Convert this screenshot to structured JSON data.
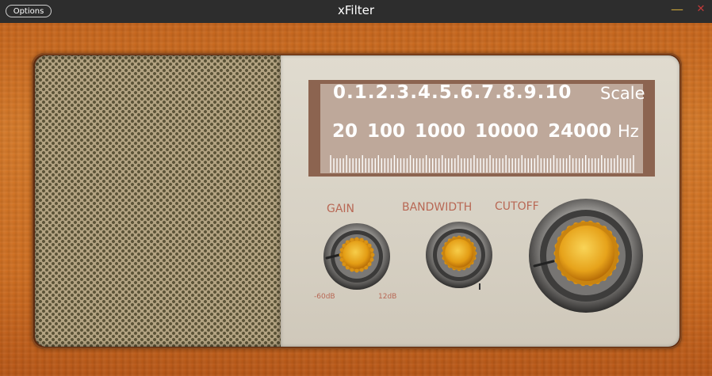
{
  "window": {
    "title": "xFilter",
    "options_label": "Options",
    "minimize_glyph": "—",
    "close_glyph": "✕"
  },
  "display": {
    "scale_numbers": "0.1.2.3.4.5.6.7.8.9.10",
    "scale_label": "Scale",
    "hz_numbers": "20 100 1000 10000 24000",
    "hz_label": "Hz"
  },
  "knobs": {
    "gain": {
      "label": "GAIN",
      "min_label": "-60dB",
      "max_label": "12dB"
    },
    "bandwidth": {
      "label": "BANDWIDTH"
    },
    "cutoff": {
      "label": "CUTOFF"
    }
  },
  "colors": {
    "wood": "#cf6f22",
    "panel": "#d7d1c4",
    "display_frame": "#8c6450",
    "display_face": "#bea89a",
    "label_text": "#b86855",
    "knob_gold": "#e8a61c"
  },
  "icons": {
    "minimize": "minimize-icon",
    "close": "close-icon",
    "knob": "knob-icon"
  }
}
